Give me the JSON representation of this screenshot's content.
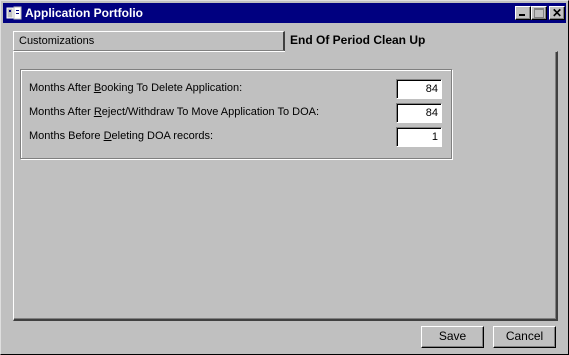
{
  "window": {
    "title": "Application Portfolio",
    "icon": "application-icon",
    "controls": [
      "minimize-icon",
      "maximize-icon",
      "close-icon"
    ]
  },
  "tabs": [
    {
      "label": "Customizations",
      "active": false
    },
    {
      "label": "End Of Period Clean Up",
      "active": true
    }
  ],
  "form": {
    "fields": [
      {
        "label_pre": "Months After ",
        "label_key": "B",
        "label_post": "ooking To Delete Application:",
        "value": "84"
      },
      {
        "label_pre": "Months After ",
        "label_key": "R",
        "label_post": "eject/Withdraw To Move Application To DOA:",
        "value": "84"
      },
      {
        "label_pre": "Months Before ",
        "label_key": "D",
        "label_post": "eleting DOA records:",
        "value": "1"
      }
    ]
  },
  "buttons": {
    "save_label": "Save",
    "cancel_label": "Cancel"
  }
}
